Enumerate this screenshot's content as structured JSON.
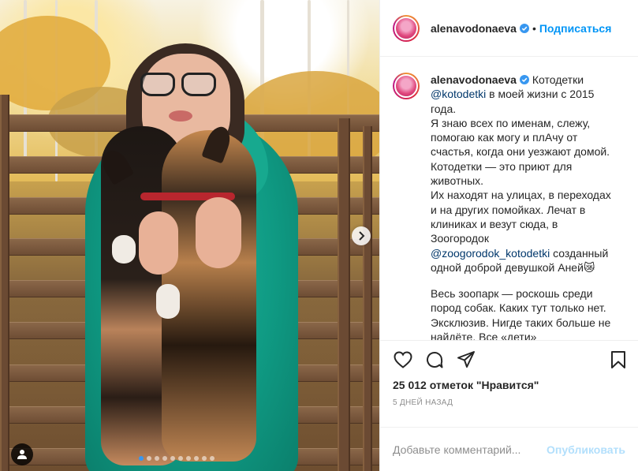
{
  "post": {
    "username": "alenavodonaeva",
    "follow_label": "Подписаться",
    "caption": {
      "line1_text": " Котодетки",
      "mention1": "@kotodetki",
      "line1_rest": " в моей жизни с 2015 года.",
      "p2": "Я знаю всех по именам, слежу, помогаю как могу и плАчу от счастья, когда они уезжают домой.",
      "p3": "Котодетки — это приют для животных.",
      "p4": "Их находят на улицах, в переходах и на других помойках. Лечат в клиниках и везут сюда, в Зоогородок",
      "mention2": "@zoogorodok_kotodetki",
      "p4_rest": " созданный одной доброй девушкой Аней😿",
      "p5": "Весь зоопарк — роскошь среди пород собак. Каких тут только нет. Эксклюзив. Нигде таких больше не найдёте. Все «дети» социализируются, занимаются с кинологом, спокойно сосут с другими"
    },
    "likes_text": "25 012 отметок \"Нравится\"",
    "time_text": "5 дней назад",
    "comment_placeholder": "Добавьте комментарий...",
    "publish_label": "Опубликовать",
    "carousel": {
      "total_slides": 10,
      "current_slide": 1
    }
  },
  "colors": {
    "accent": "#0095f6",
    "publish_disabled": "#b2dffc",
    "jacket": "#0f9a83"
  }
}
